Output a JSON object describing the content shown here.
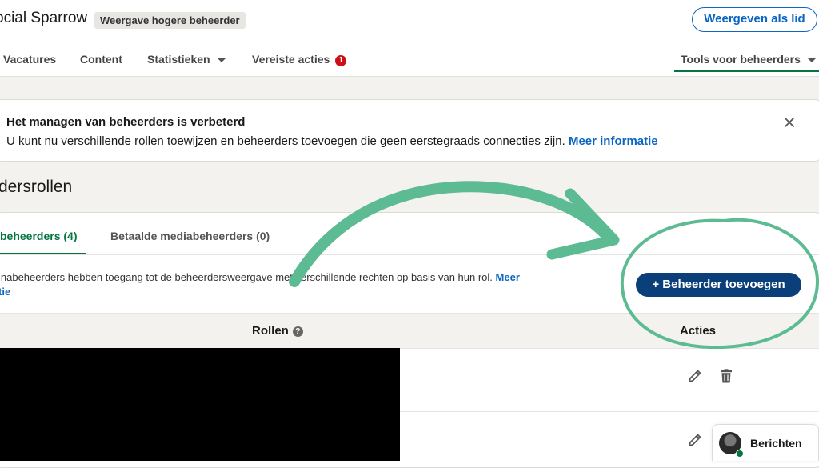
{
  "header": {
    "company_name": "ocial Sparrow",
    "view_badge": "Weergave hogere beheerder",
    "view_as_member_label": "Weergeven als lid"
  },
  "nav": {
    "tabs": [
      {
        "label": "Vacatures"
      },
      {
        "label": "Content"
      },
      {
        "label": "Statistieken"
      },
      {
        "label": "Vereiste acties",
        "badge": "1"
      },
      {
        "label": "Tools voor beheerders",
        "active": true
      }
    ]
  },
  "banner": {
    "title": "Het managen van beheerders is verbeterd",
    "text": "U kunt nu verschillende rollen toewijzen en beheerders toevoegen die geen eerstegraads connecties zijn.",
    "link": "Meer informatie"
  },
  "section": {
    "title": "dersrollen",
    "tabs": [
      {
        "label": "beheerders (4)",
        "active": true
      },
      {
        "label": "Betaalde mediabeheerders (0)"
      }
    ],
    "description": "inabeheerders hebben toegang tot de beheerdersweergave met verschillende rechten op basis van hun rol.",
    "description_link_1": "Meer",
    "description_link_2": "tie",
    "add_button_label": "+ Beheerder toevoegen"
  },
  "table": {
    "col_roles": "Rollen",
    "col_actions": "Acties"
  },
  "messaging": {
    "label": "Berichten"
  },
  "colors": {
    "brand_blue": "#0a66c2",
    "primary_button": "#0a3f7a",
    "active_green": "#057642",
    "annotation_green": "#5dbb93",
    "badge_red": "#cc1016"
  }
}
